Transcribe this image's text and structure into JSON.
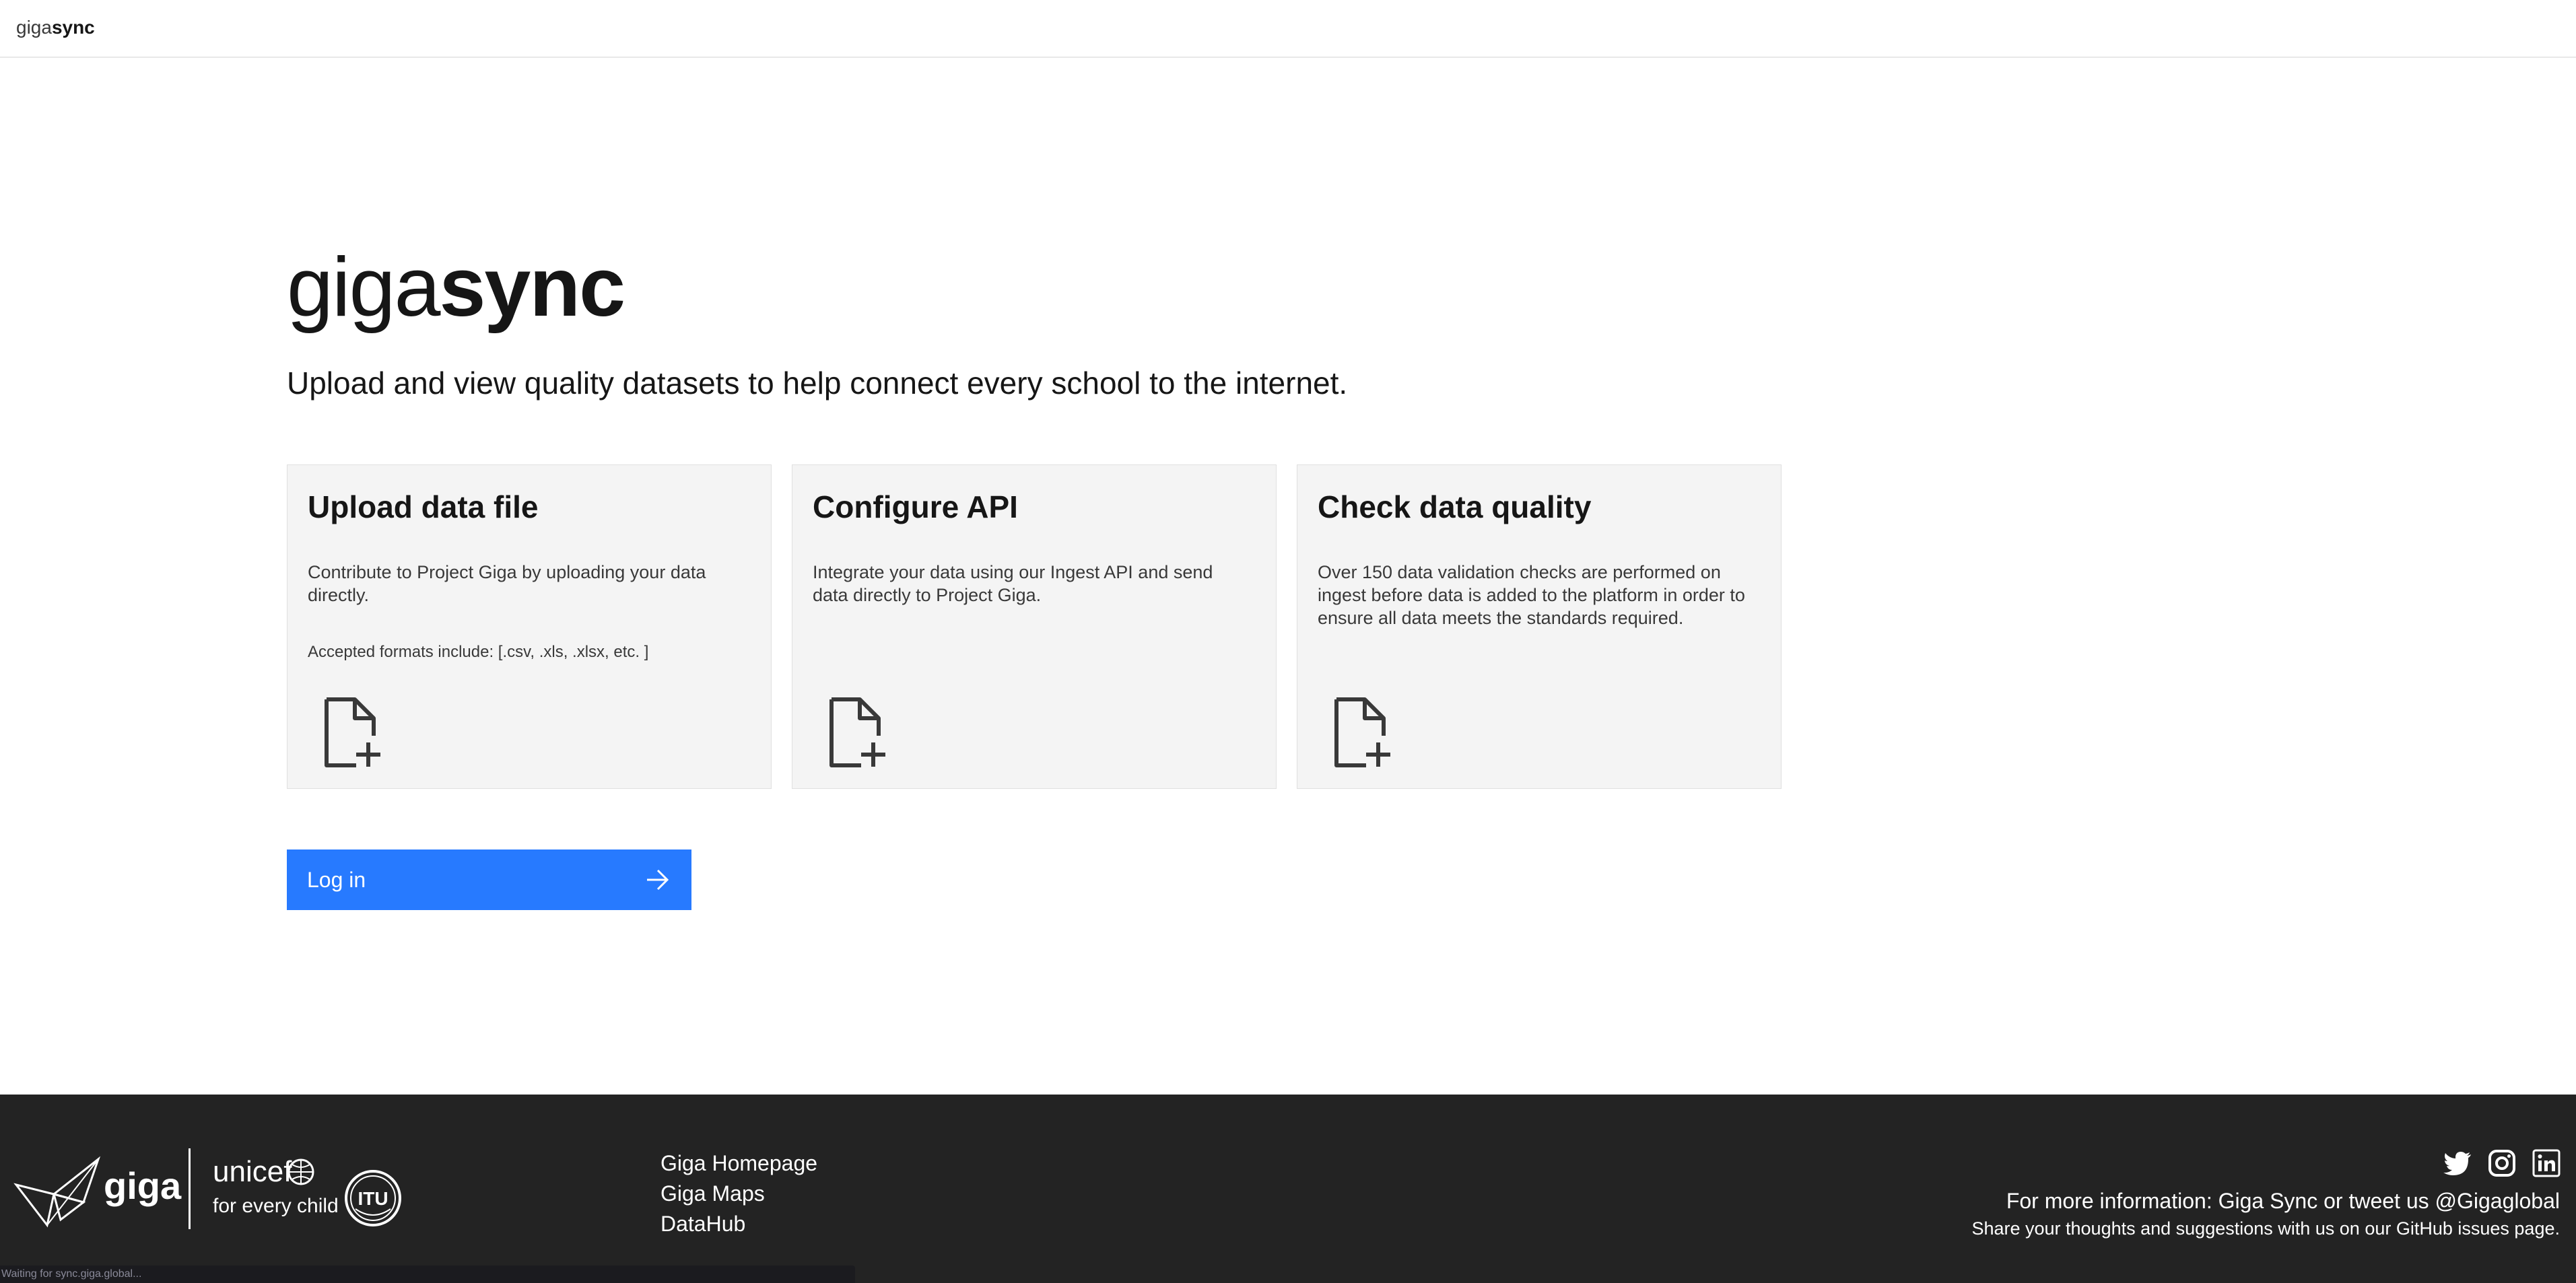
{
  "header": {
    "brand_light": "giga",
    "brand_bold": "sync"
  },
  "hero": {
    "title_light": "giga",
    "title_bold": "sync",
    "subtitle": "Upload and view quality datasets to help connect every school to the internet."
  },
  "cards": [
    {
      "title": "Upload data file",
      "description": "Contribute to Project Giga by uploading your data directly.",
      "formats": "Accepted formats include: [.csv, .xls, .xlsx, etc. ]",
      "icon": "document-add-icon"
    },
    {
      "title": "Configure API",
      "description": "Integrate your data using our Ingest API and send data directly to Project Giga.",
      "icon": "document-add-icon"
    },
    {
      "title": "Check data quality",
      "description": "Over 150 data validation checks are performed on ingest before data is added to the platform in order to ensure all data meets the standards required.",
      "icon": "document-add-icon"
    }
  ],
  "login": {
    "label": "Log in",
    "icon": "arrow-right-icon",
    "color": "#277AFF"
  },
  "footer": {
    "logos": {
      "giga": "giga",
      "unicef": "unicef",
      "unicef_tagline": "for every child",
      "itu": "ITU"
    },
    "links": [
      "Giga Homepage",
      "Giga Maps",
      "DataHub"
    ],
    "social": [
      "twitter-icon",
      "instagram-icon",
      "linkedin-icon"
    ],
    "info_line1": "For more information: Giga Sync or tweet us @Gigaglobal",
    "info_line2": "Share your thoughts and suggestions with us on our GitHub issues page.",
    "background": "#232323"
  },
  "status_bar": {
    "text": "Waiting for sync.giga.global..."
  }
}
